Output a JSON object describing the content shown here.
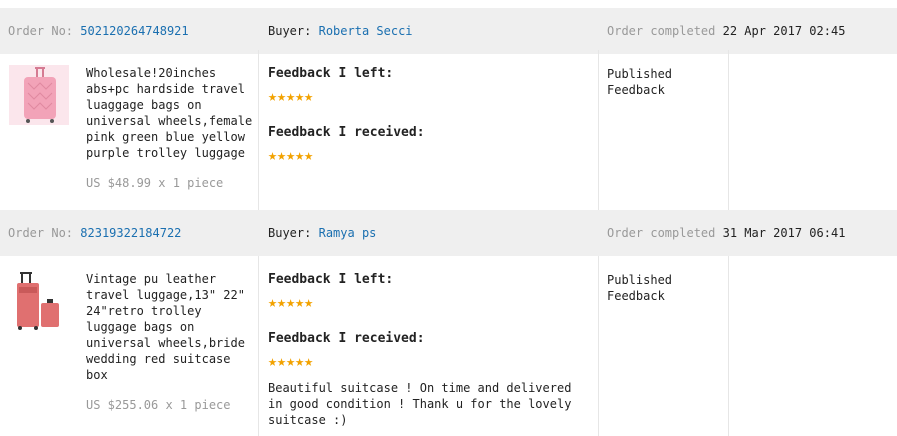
{
  "orders": [
    {
      "order_label": "Order No:",
      "order_no": "502120264748921",
      "buyer_label": "Buyer:",
      "buyer": "Roberta Secci",
      "status": "Order completed",
      "date": "22 Apr 2017 02:45",
      "product_title": "Wholesale!20inches abs+pc hardside travel luaggage bags on universal wheels,female pink green blue yellow purple trolley luggage",
      "price": "US $48.99 x 1 piece",
      "feedback_left_label": "Feedback I left:",
      "feedback_left_stars": 5,
      "feedback_received_label": "Feedback I received:",
      "feedback_received_stars": 5,
      "review": "",
      "published": "Published Feedback",
      "thumb_color": "#f2a3b8"
    },
    {
      "order_label": "Order No:",
      "order_no": "82319322184722",
      "buyer_label": "Buyer:",
      "buyer": "Ramya ps",
      "status": "Order completed",
      "date": "31 Mar 2017 06:41",
      "product_title": "Vintage pu leather travel luggage,13\" 22\" 24\"retro trolley luggage bags on universal wheels,bride wedding red suitcase box",
      "price": "US $255.06 x 1 piece",
      "feedback_left_label": "Feedback I left:",
      "feedback_left_stars": 5,
      "feedback_received_label": "Feedback I received:",
      "feedback_received_stars": 5,
      "review": "Beautiful suitcase ! On time and delivered in good condition ! Thank u for the lovely suitcase :)",
      "published": "Published Feedback",
      "thumb_color": "#e07070"
    }
  ],
  "icons": {
    "star": "star-icon"
  },
  "colors": {
    "star": "#f2a200",
    "link": "#1a6fb0",
    "header_bg": "#efefef"
  }
}
